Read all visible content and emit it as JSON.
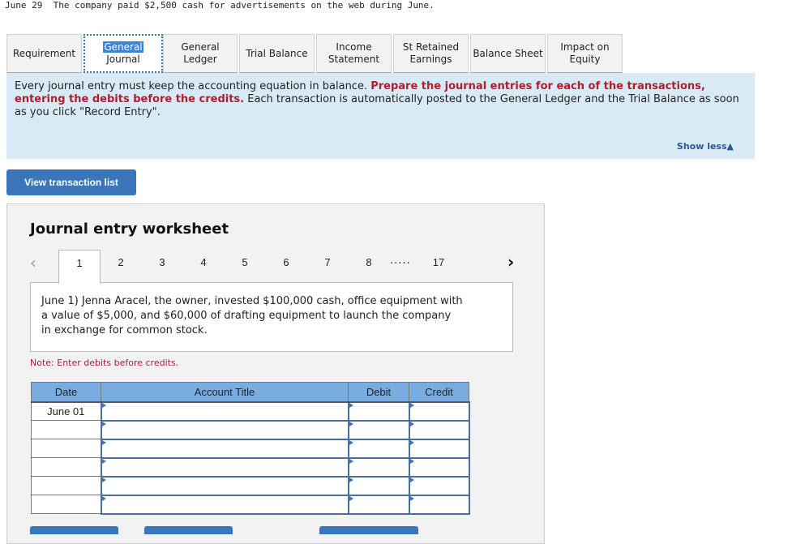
{
  "transaction_header": "June 29  The company paid $2,500 cash for advertisements on the web during June.",
  "tabs": [
    {
      "line1": "Requirement",
      "line2": "",
      "active": false
    },
    {
      "line1": "General",
      "line2": "Journal",
      "active": true
    },
    {
      "line1": "General",
      "line2": "Ledger",
      "active": false
    },
    {
      "line1": "Trial Balance",
      "line2": "",
      "active": false
    },
    {
      "line1": "Income",
      "line2": "Statement",
      "active": false
    },
    {
      "line1": "St Retained",
      "line2": "Earnings",
      "active": false
    },
    {
      "line1": "Balance Sheet",
      "line2": "",
      "active": false
    },
    {
      "line1": "Impact on",
      "line2": "Equity",
      "active": false
    }
  ],
  "instructions": {
    "part1": "Every journal entry must keep the accounting equation in balance.  ",
    "bold_red": "Prepare the journal entries for each of the transactions, entering the debits before the credits.",
    "part2": "  Each transaction is automatically posted to the General Ledger and the Trial Balance as soon as you click \"Record Entry\".",
    "show_less": "Show less",
    "show_less_icon": "▲"
  },
  "view_transaction_button": "View transaction list",
  "worksheet": {
    "title": "Journal entry worksheet",
    "prev_icon": "‹",
    "next_icon": "›",
    "pages": [
      "1",
      "2",
      "3",
      "4",
      "5",
      "6",
      "7",
      "8",
      "17"
    ],
    "active_page": "1",
    "ellipsis": ".....",
    "transaction_text": "June 1) Jenna Aracel, the owner, invested $100,000 cash, office equipment with a value of $5,000, and $60,000 of drafting equipment to launch the company in exchange for common stock.",
    "note": "Note: Enter debits before credits.",
    "table": {
      "headers": [
        "Date",
        "Account Title",
        "Debit",
        "Credit"
      ],
      "rows": [
        {
          "date": "June 01",
          "account": "",
          "debit": "",
          "credit": ""
        },
        {
          "date": "",
          "account": "",
          "debit": "",
          "credit": ""
        },
        {
          "date": "",
          "account": "",
          "debit": "",
          "credit": ""
        },
        {
          "date": "",
          "account": "",
          "debit": "",
          "credit": ""
        },
        {
          "date": "",
          "account": "",
          "debit": "",
          "credit": ""
        },
        {
          "date": "",
          "account": "",
          "debit": "",
          "credit": ""
        }
      ]
    }
  },
  "colors": {
    "accent_blue": "#3a76b9",
    "info_bg": "#d9eaf7",
    "table_header": "#79ade2",
    "emphasis_red": "#b01e2e"
  }
}
